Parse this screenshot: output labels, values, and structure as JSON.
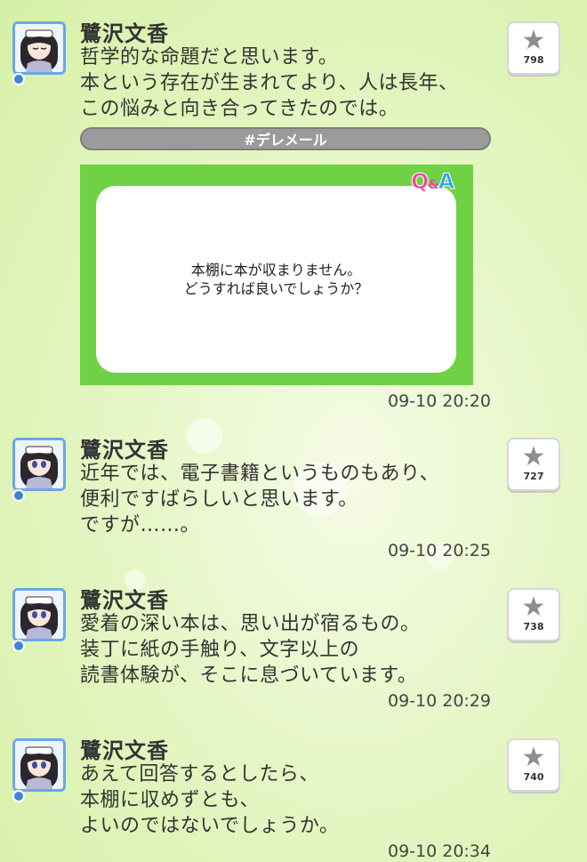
{
  "posts": [
    {
      "name": "鷺沢文香",
      "lines": [
        "哲学的な命題だと思います。",
        "本という存在が生まれてより、人は長年、",
        "この悩みと向き合ってきたのでは。"
      ],
      "tag": "#デレメール",
      "card": {
        "logo_q": "Q",
        "logo_amp": "&",
        "logo_a": "A",
        "lines": [
          "本棚に本が収まりません。",
          "どうすれば良いでしょうか？"
        ]
      },
      "time": "09-10 20:20",
      "likes": "798"
    },
    {
      "name": "鷺沢文香",
      "lines": [
        "近年では、電子書籍というものもあり、",
        "便利ですばらしいと思います。",
        "ですが……。"
      ],
      "time": "09-10 20:25",
      "likes": "727"
    },
    {
      "name": "鷺沢文香",
      "lines": [
        "愛着の深い本は、思い出が宿るもの。",
        "装丁に紙の手触り、文字以上の",
        "読書体験が、そこに息づいています。"
      ],
      "time": "09-10 20:29",
      "likes": "738"
    },
    {
      "name": "鷺沢文香",
      "lines": [
        "あえて回答するとしたら、",
        "本棚に収めずとも、",
        "よいのではないでしょうか。"
      ],
      "time": "09-10 20:34",
      "likes": "740"
    }
  ],
  "icons": {
    "like": "star-icon",
    "badge": "diamond-badge-icon"
  },
  "colors": {
    "card_green": "#6fd244",
    "avatar_border": "#6aa7e6",
    "tag_gray": "#9b9b9b"
  }
}
